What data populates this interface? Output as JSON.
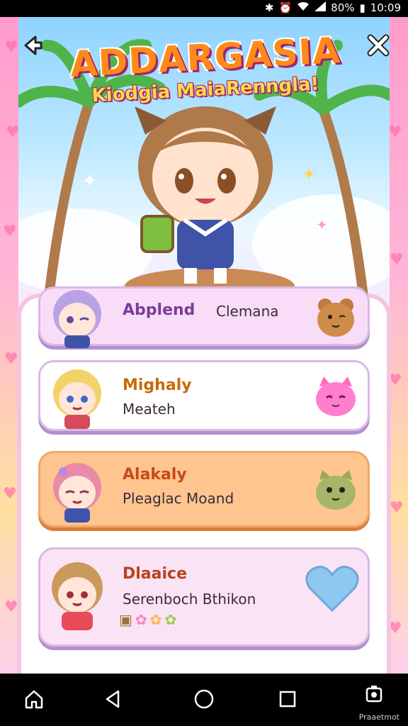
{
  "status": {
    "time": "10:09",
    "battery": "80%"
  },
  "header": {
    "title": "ADDARGASIA",
    "subtitle": "Kiodgia MaiaRenngla!"
  },
  "icons": {
    "back": "back-arrow-icon",
    "close": "close-x-icon"
  },
  "cards": [
    {
      "name": "Abplend",
      "sub": "Clemana",
      "color": "#f9dcf7",
      "pet": "bear-pet-icon"
    },
    {
      "name": "Mighaly",
      "sub": "Meateh",
      "color": "#ffffff",
      "pet": "pink-cat-pet-icon"
    },
    {
      "name": "Alakaly",
      "sub": "Pleaglac Moand",
      "color": "#ffc58f",
      "pet": "green-cat-pet-icon"
    },
    {
      "name": "Dlaaice",
      "sub": "Serenboch Bthikon",
      "color": "#fbe3f6",
      "pet": "heart-icon"
    }
  ],
  "navbar": {
    "label": "Praaetmot"
  },
  "colors": {
    "accent": "#ff8a1a",
    "name_text": "#7a3d9a",
    "frame_pink": "#f6c3e0"
  }
}
